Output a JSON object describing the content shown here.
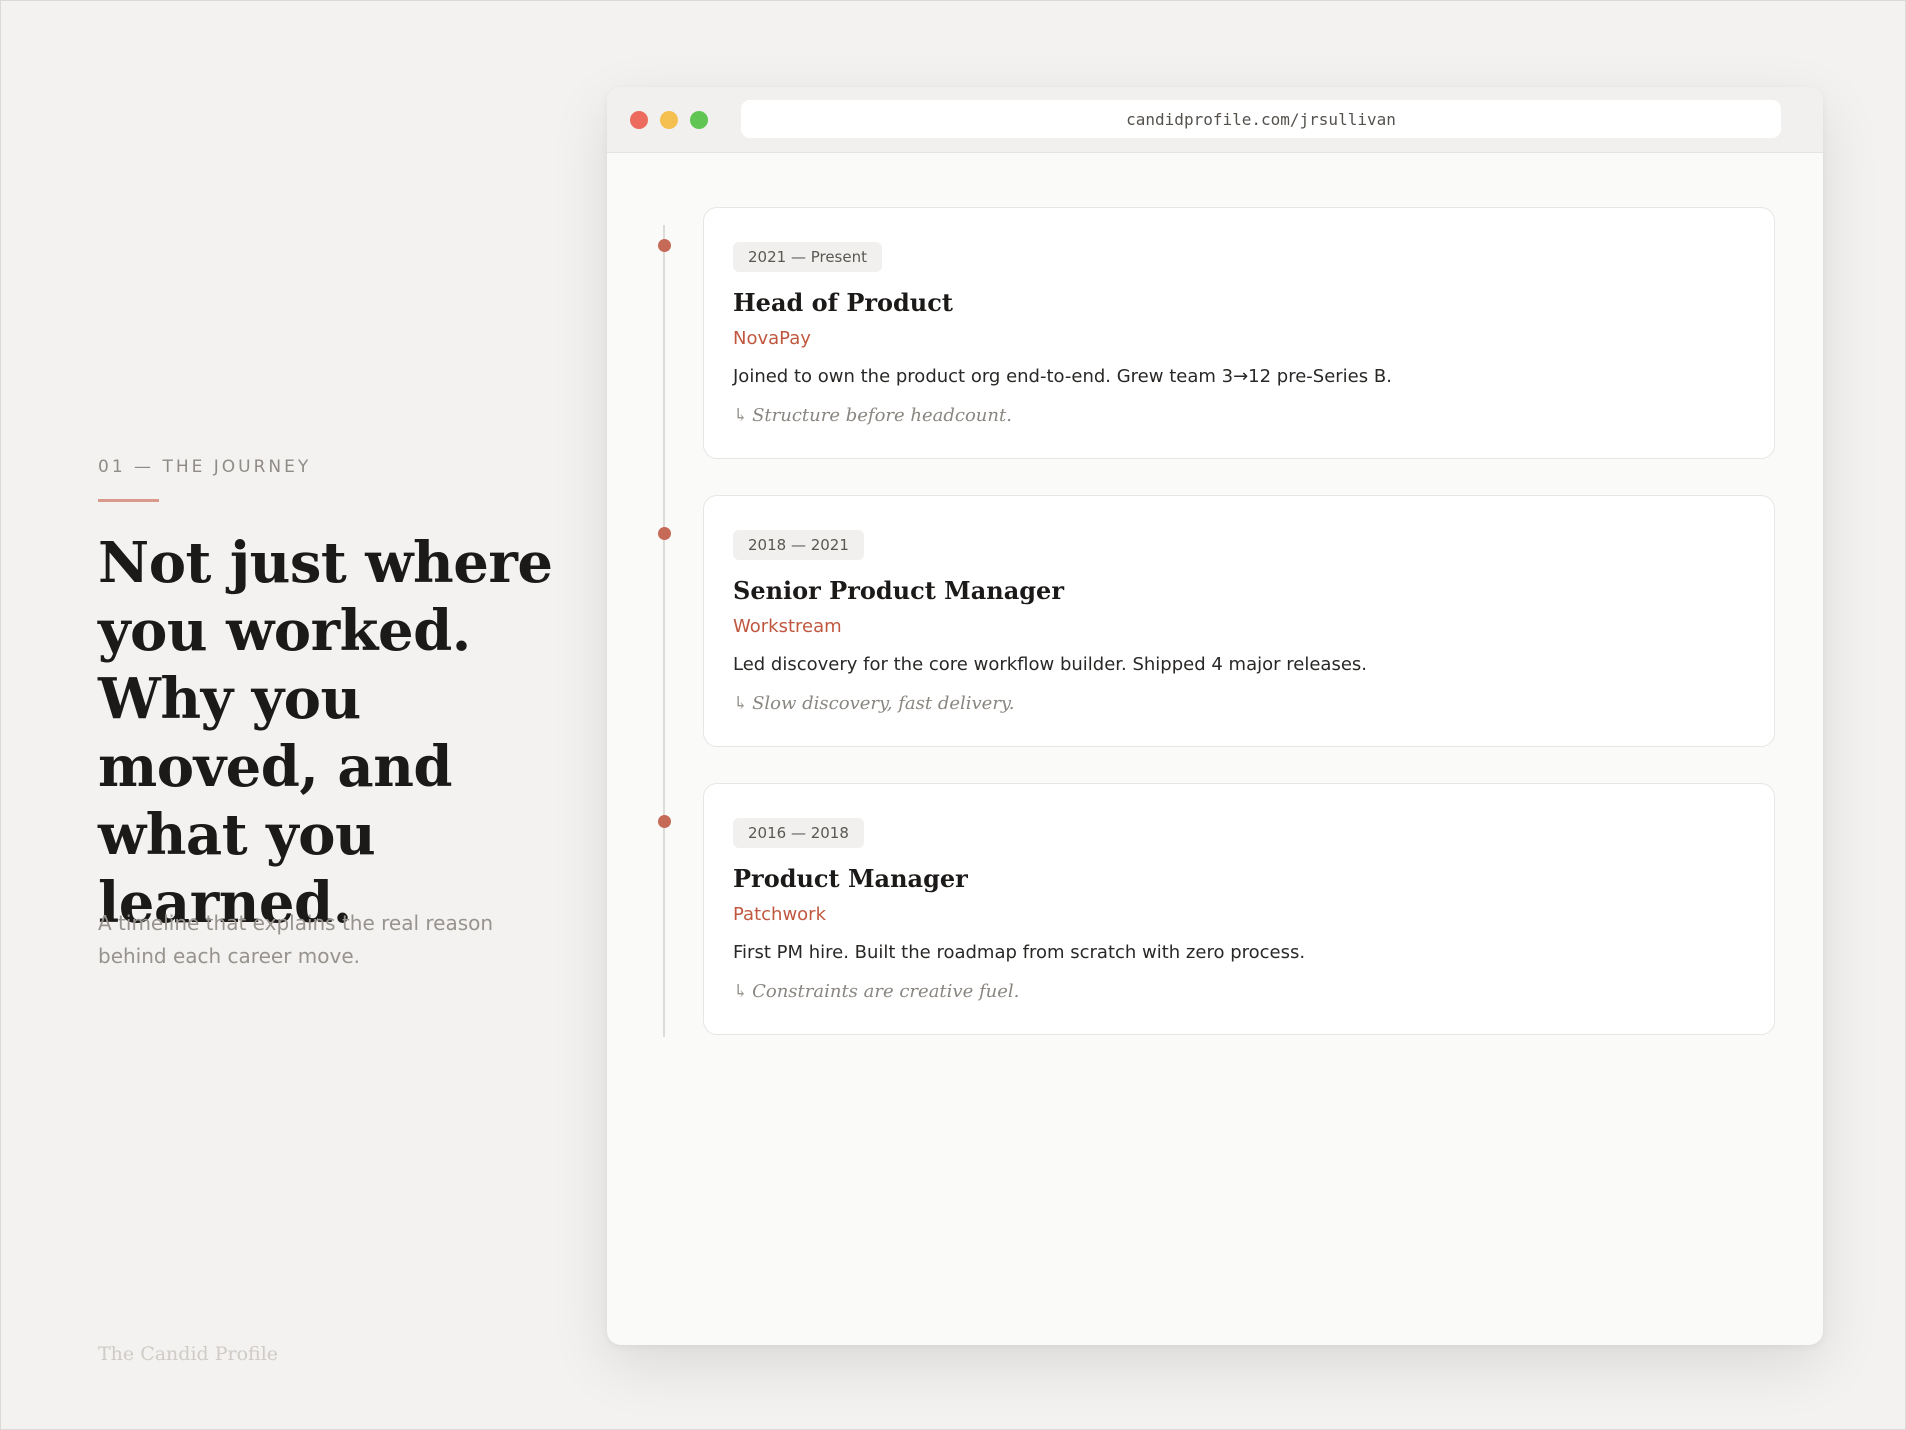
{
  "left": {
    "eyebrow": "01 — THE JOURNEY",
    "headline": "Not just where you worked. Why you moved, and what you learned.",
    "subtext": "A timeline that explains the real reason behind each career move.",
    "footer_brand": "The Candid Profile"
  },
  "browser": {
    "url": "candidprofile.com/jrsullivan"
  },
  "timeline": [
    {
      "dates": "2021 — Present",
      "role": "Head of Product",
      "company": "NovaPay",
      "description": "Joined to own the product org end-to-end. Grew team 3→12 pre-Series B.",
      "lesson": "Structure before headcount."
    },
    {
      "dates": "2018 — 2021",
      "role": "Senior Product Manager",
      "company": "Workstream",
      "description": "Led discovery for the core workflow builder. Shipped 4 major releases.",
      "lesson": "Slow discovery, fast delivery."
    },
    {
      "dates": "2016 — 2018",
      "role": "Product Manager",
      "company": "Patchwork",
      "description": "First PM hire. Built the roadmap from scratch with zero process.",
      "lesson": "Constraints are creative fuel."
    }
  ],
  "icons": {
    "lesson_arrow": "return-arrow-icon",
    "lesson_arrow_glyph": "↳"
  },
  "colors": {
    "accent": "#c0573f",
    "timeline_dot": "#c46a56",
    "background": "#f3f2f0"
  }
}
